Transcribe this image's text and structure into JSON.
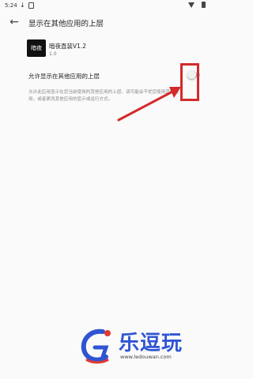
{
  "status_bar": {
    "time": "5:24"
  },
  "app_bar": {
    "title": "显示在其他应用的上层"
  },
  "app_info": {
    "icon_text": "暗夜",
    "name": "暗夜直装V1.2",
    "version": "1.0"
  },
  "setting": {
    "label": "允许显示在其他应用的上层",
    "enabled": false,
    "description": "允许此应用显示在您当前使用的其他应用的上层。该可能会干扰您使用其他应用，或者更改其他应用的显示或运行方式。"
  },
  "watermark": {
    "text": "乐逗玩",
    "url": "www.ledouwan.com"
  },
  "colors": {
    "highlight": "#d42a2a",
    "logo_blue": "#2f55d4",
    "logo_red": "#e03a2f"
  }
}
